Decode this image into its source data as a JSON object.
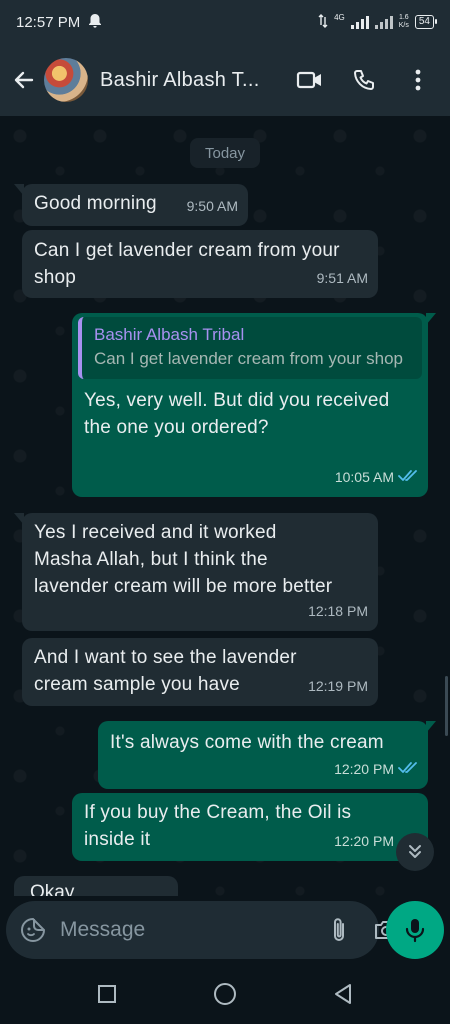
{
  "status_bar": {
    "time": "12:57 PM",
    "network": "4G",
    "speed_value": "1.6",
    "speed_unit": "K/s",
    "battery": "54"
  },
  "header": {
    "contact_name": "Bashir Albash T...",
    "icons": [
      "back-arrow-icon",
      "video-call-icon",
      "phone-icon",
      "more-options-icon"
    ]
  },
  "chat": {
    "date_label": "Today",
    "messages": [
      {
        "direction": "in",
        "text": "Good morning",
        "time": "9:50 AM"
      },
      {
        "direction": "in",
        "text": "Can I get lavender cream from your shop",
        "time": "9:51 AM"
      },
      {
        "direction": "out",
        "quote_author": "Bashir Albash Tribal",
        "quote_text": "Can I get lavender cream from your shop",
        "text": "Yes, very well. But did you received the one you ordered?",
        "time": "10:05 AM",
        "status": "read"
      },
      {
        "direction": "in",
        "text": "Yes I received and it worked Masha Allah, but I think the lavender cream will be more better",
        "time": "12:18 PM"
      },
      {
        "direction": "in",
        "text": "And I want to see the lavender cream sample you have",
        "time": "12:19 PM"
      },
      {
        "direction": "out",
        "text": "It's always come with the cream",
        "time": "12:20 PM",
        "status": "read"
      },
      {
        "direction": "out",
        "text": "If you buy the Cream, the Oil is inside it",
        "time": "12:20 PM"
      }
    ],
    "partial_message": "Okay"
  },
  "input": {
    "placeholder": "Message"
  },
  "colors": {
    "incoming_bubble": "#202c33",
    "outgoing_bubble": "#005c4b",
    "accent": "#00a884",
    "read_ticks": "#53bdeb",
    "quote_author": "#a791f0"
  }
}
